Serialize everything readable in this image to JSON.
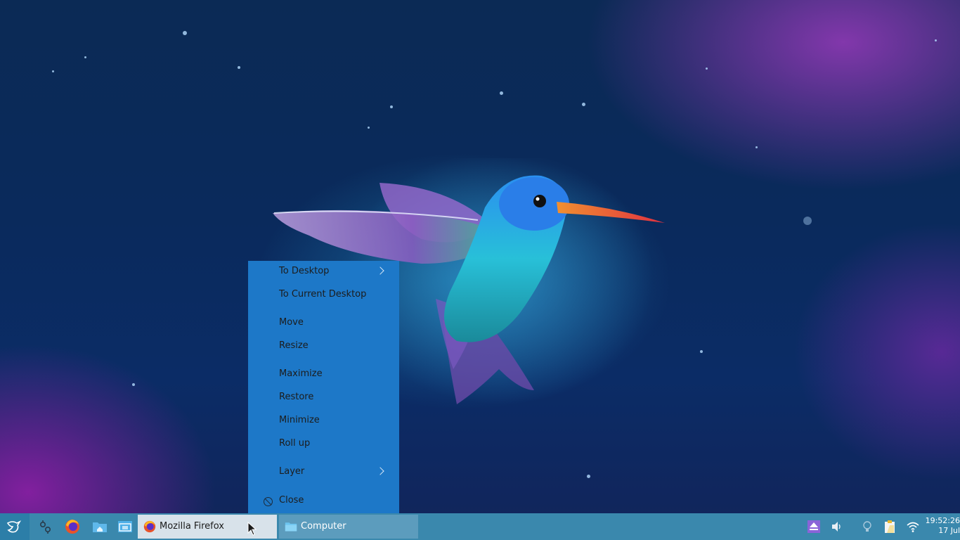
{
  "menu": {
    "items": [
      {
        "label": "To Desktop",
        "submenu": true
      },
      {
        "label": "To Current Desktop",
        "submenu": false
      },
      {
        "label": "Move",
        "submenu": false
      },
      {
        "label": "Resize",
        "submenu": false
      },
      {
        "label": "Maximize",
        "submenu": false
      },
      {
        "label": "Restore",
        "submenu": false
      },
      {
        "label": "Minimize",
        "submenu": false
      },
      {
        "label": "Roll up",
        "submenu": false
      },
      {
        "label": "Layer",
        "submenu": true
      },
      {
        "label": "Close",
        "submenu": false,
        "icon": "close-circle-icon"
      }
    ],
    "background": "#1d78c8"
  },
  "taskbar": {
    "background": "#3a88ad",
    "launcher_icon": "kde-logo-icon",
    "quicklaunch": [
      "settings-icon",
      "firefox-icon",
      "home-folder-icon",
      "window-manager-icon"
    ],
    "tasks": [
      {
        "label": "Mozilla Firefox",
        "icon": "firefox-icon",
        "active": true
      },
      {
        "label": "Computer",
        "icon": "folder-icon",
        "active": false
      }
    ],
    "tray": [
      "eject-icon",
      "volume-icon",
      "lightbulb-icon",
      "clipboard-icon",
      "wifi-icon"
    ],
    "clock": {
      "time": "19:52:26",
      "date": "17 Jul"
    }
  }
}
